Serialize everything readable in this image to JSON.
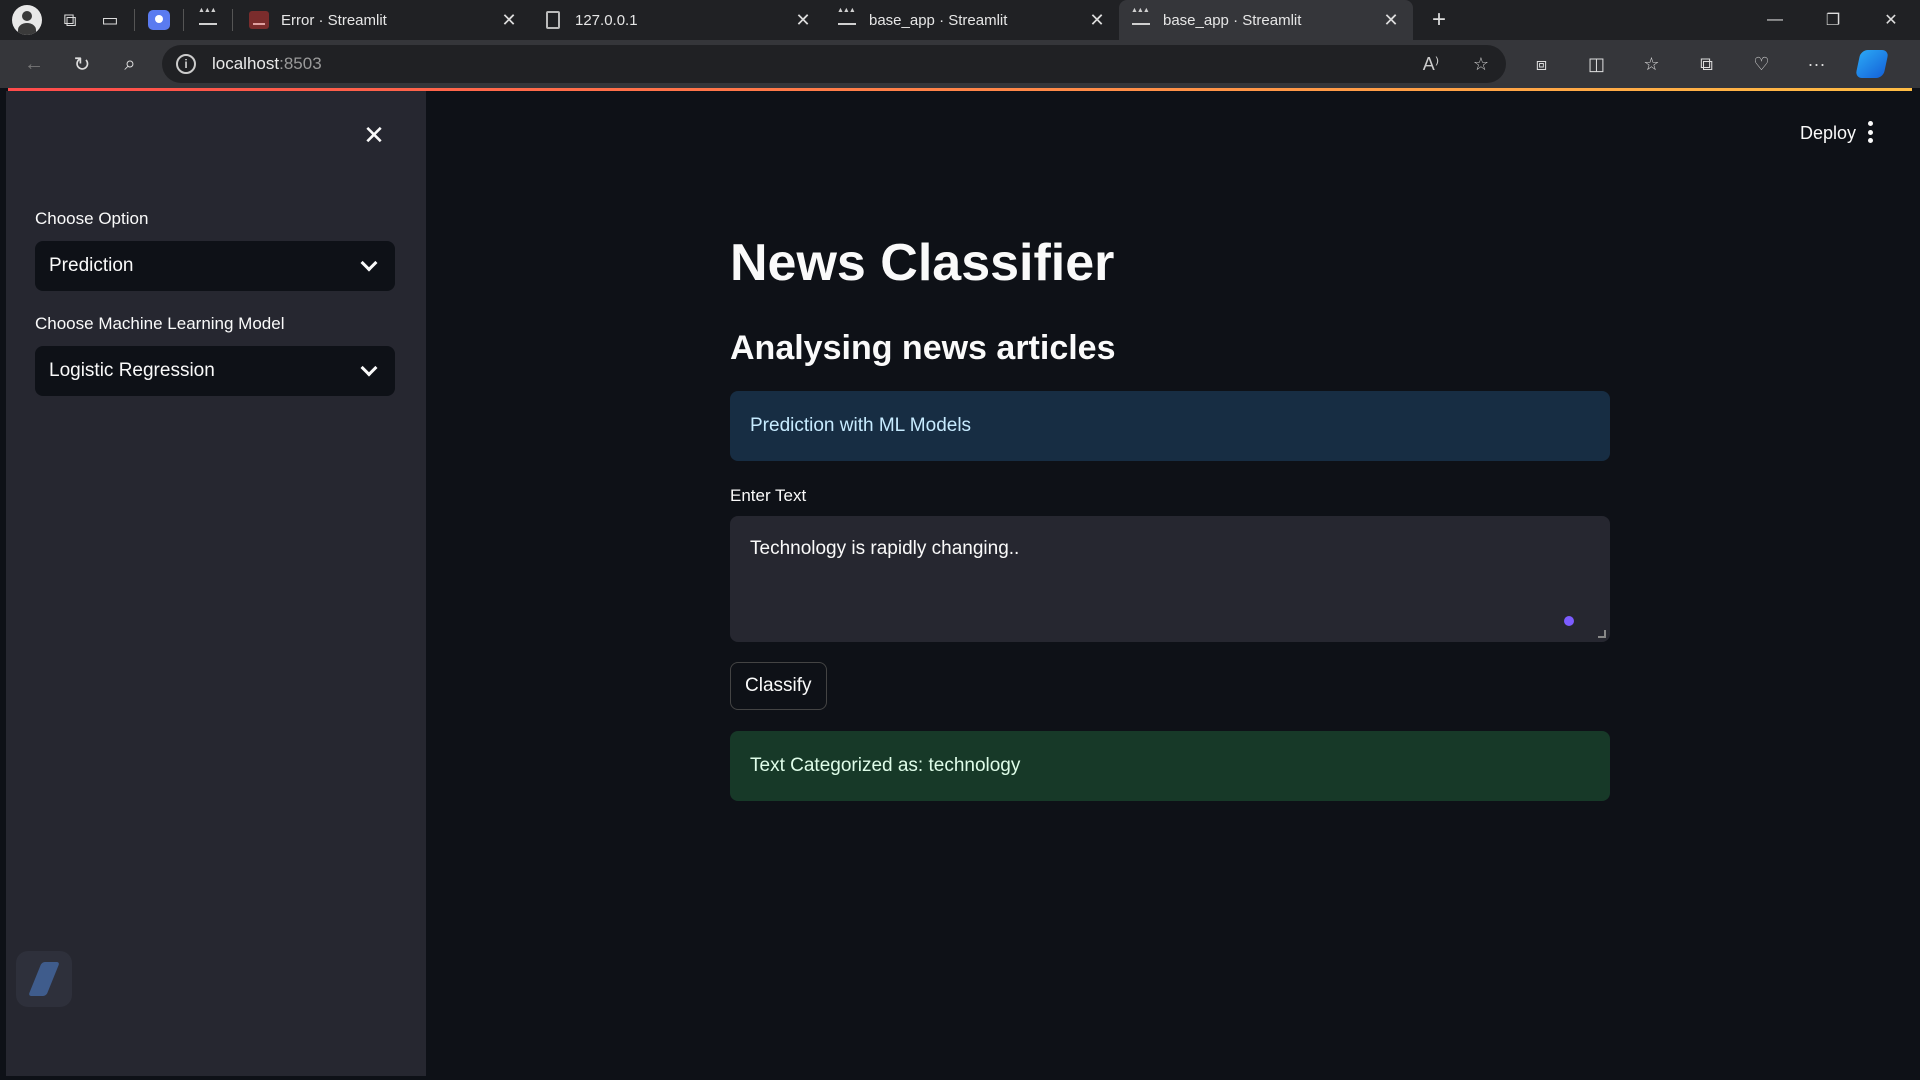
{
  "browser": {
    "tabs": [
      {
        "title": "Error · Streamlit",
        "favicon": "streamlit-error-favicon",
        "active": false
      },
      {
        "title": "127.0.0.1",
        "favicon": "document-favicon",
        "active": false
      },
      {
        "title": "base_app · Streamlit",
        "favicon": "streamlit-crown-favicon",
        "active": false
      },
      {
        "title": "base_app · Streamlit",
        "favicon": "streamlit-crown-favicon",
        "active": true
      }
    ],
    "url_host": "localhost",
    "url_port": ":8503"
  },
  "sidebar": {
    "option_label": "Choose Option",
    "option_value": "Prediction",
    "model_label": "Choose Machine Learning Model",
    "model_value": "Logistic Regression"
  },
  "header": {
    "deploy_label": "Deploy"
  },
  "main": {
    "title": "News Classifier",
    "subtitle": "Analysing news articles",
    "info_text": "Prediction with ML Models",
    "input_label": "Enter Text",
    "input_value": "Technology is rapidly changing..",
    "button_label": "Classify",
    "result_text": "Text Categorized as: technology"
  },
  "colors": {
    "background": "#0e1117",
    "sidebar": "#262730",
    "info": "#172d43",
    "success": "#173928",
    "accent_gradient_start": "#ff4b4b",
    "accent_gradient_end": "#ffbd45"
  }
}
